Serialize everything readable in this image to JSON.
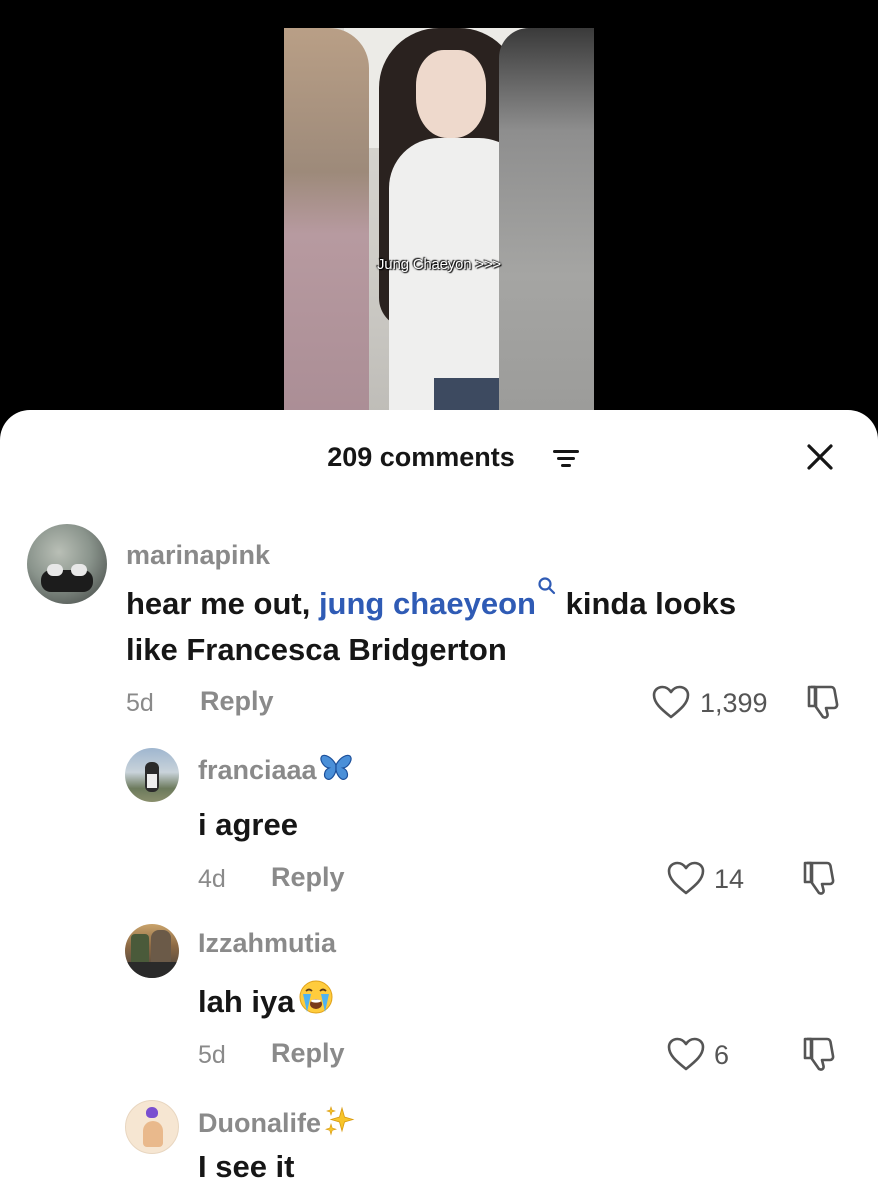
{
  "video": {
    "caption": "Jung Chaeyon >>>"
  },
  "comments_panel": {
    "count_label": "209 comments"
  },
  "comments": [
    {
      "username": "marinapink",
      "text_before": "hear me out, ",
      "mention": "jung chaeyeon",
      "text_after_line1": " kinda looks",
      "text_line2": "like Francesca Bridgerton",
      "time": "5d",
      "reply_label": "Reply",
      "likes": "1,399"
    },
    {
      "username": "franciaaa",
      "text": "i agree",
      "time": "4d",
      "reply_label": "Reply",
      "likes": "14"
    },
    {
      "username": "Izzahmutia",
      "text": "lah iya",
      "time": "5d",
      "reply_label": "Reply",
      "likes": "6"
    },
    {
      "username": "Duonalife",
      "text": "I see it"
    }
  ],
  "colors": {
    "mention": "#2f5bb5",
    "muted": "#8a8a8a",
    "text": "#161616"
  }
}
